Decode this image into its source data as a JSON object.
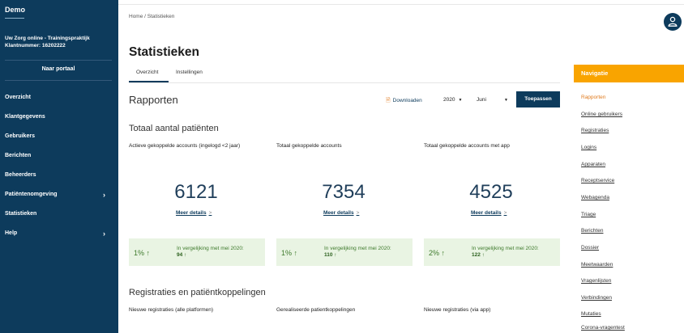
{
  "sidebar": {
    "brand": "Demo",
    "org_line1": "Uw Zorg online - Trainingspraktijk",
    "org_line2": "Klantnummer: 16202222",
    "portal_button": "Naar portaal",
    "items": [
      {
        "label": "Overzicht"
      },
      {
        "label": "Klantgegevens"
      },
      {
        "label": "Gebruikers"
      },
      {
        "label": "Berichten"
      },
      {
        "label": "Beheerders"
      },
      {
        "label": "Patiëntenomgeving",
        "chevron": "›"
      },
      {
        "label": "Statistieken"
      },
      {
        "label": "Help",
        "chevron": "›"
      }
    ]
  },
  "breadcrumb": "Home / Statistieken",
  "page_title": "Statistieken",
  "tabs": [
    {
      "label": "Overzicht",
      "active": true
    },
    {
      "label": "Instellingen",
      "active": false
    }
  ],
  "reports": {
    "title": "Rapporten",
    "download_label": "Downloaden",
    "year": "2020",
    "month": "Juni",
    "apply_label": "Toepassen"
  },
  "patients_section": {
    "title": "Totaal aantal patiënten",
    "cards": [
      {
        "label": "Actieve gekoppelde accounts (ingelogd <2 jaar)",
        "value": "6121",
        "details": "Meer details",
        "pct": "1% ↑",
        "compare": "In vergelijking met mei 2020:",
        "compare_value": "94 ↑"
      },
      {
        "label": "Totaal gekoppelde accounts",
        "value": "7354",
        "details": "Meer details",
        "pct": "1% ↑",
        "compare": "In vergelijking met mei 2020:",
        "compare_value": "110 ↑"
      },
      {
        "label": "Totaal gekoppelde accounts met app",
        "value": "4525",
        "details": "Meer details",
        "pct": "2% ↑",
        "compare": "In vergelijking met mei 2020:",
        "compare_value": "122 ↑"
      }
    ]
  },
  "registrations_section": {
    "title": "Registraties en patiëntkoppelingen",
    "labels": [
      "Nieuwe registraties (alle platformen)",
      "Gerealiseerde patientkoppelingen",
      "Nieuwe registraties (via app)"
    ]
  },
  "right_nav": {
    "title": "Navigatie",
    "items": [
      "Rapporten",
      "Online gebruikers",
      "Registraties",
      "Logins",
      "Apparaten",
      "Receptservice",
      "Webagenda",
      "Triage",
      "Berichten",
      "Dossier",
      "Meetwaarden",
      "Vragenlijsten",
      "Verbindingen",
      "Mutaties",
      "Corona-vragentest"
    ]
  },
  "colors": {
    "sidebar_bg": "#0d3b5c",
    "accent_orange": "#f9a400",
    "positive_green": "#3e7a2c"
  },
  "icons": {
    "avatar": "user-icon",
    "download": "document-icon",
    "chevron": "chevron-right-icon"
  }
}
